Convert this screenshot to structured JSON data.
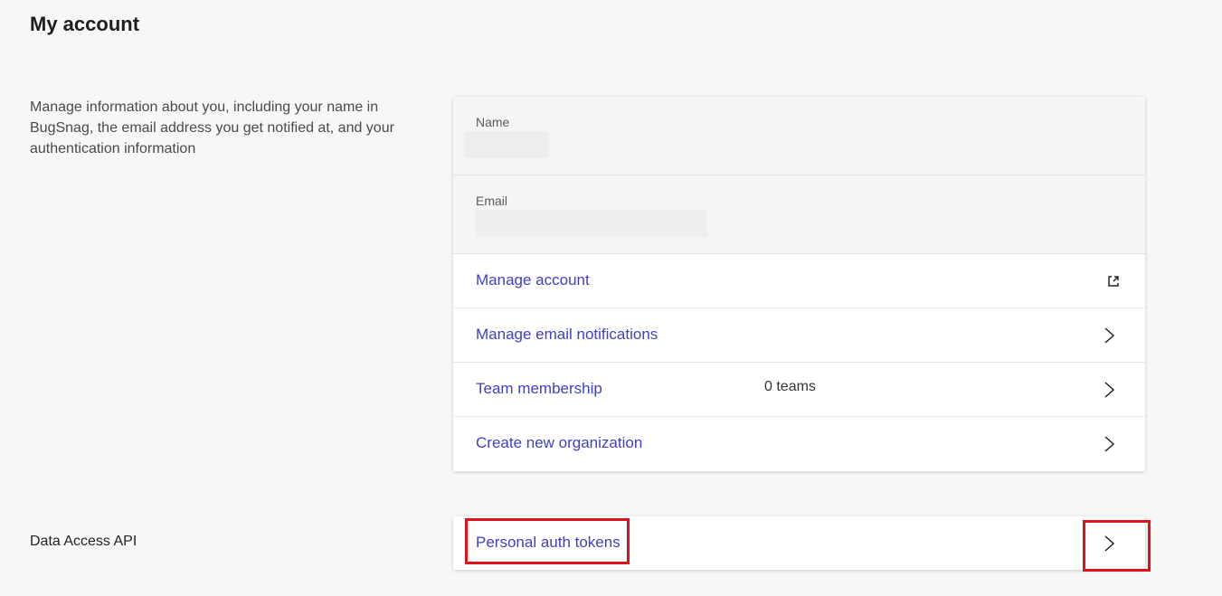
{
  "page": {
    "title": "My account"
  },
  "account_section": {
    "description": "Manage information about you, including your name in BugSnag, the email address you get notified at, and your authentication information",
    "fields": {
      "name_label": "Name",
      "email_label": "Email"
    },
    "rows": [
      {
        "label": "Manage account",
        "icon": "external-link-icon"
      },
      {
        "label": "Manage email notifications",
        "icon": "chevron-right-icon"
      },
      {
        "label": "Team membership",
        "meta": "0 teams",
        "icon": "chevron-right-icon"
      },
      {
        "label": "Create new organization",
        "icon": "chevron-right-icon"
      }
    ]
  },
  "api_section": {
    "label": "Data Access API",
    "rows": [
      {
        "label": "Personal auth tokens",
        "icon": "chevron-right-icon"
      }
    ]
  },
  "colors": {
    "link": "#4040c2",
    "highlight": "#e0121d",
    "background": "#f7f7f7"
  }
}
